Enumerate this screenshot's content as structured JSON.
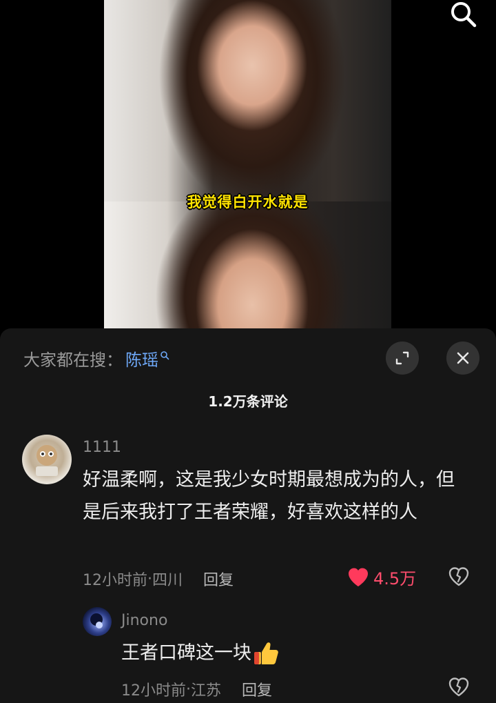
{
  "video": {
    "subtitle": "我觉得白开水就是"
  },
  "icons": {
    "search": "search-icon",
    "expand": "expand-icon",
    "close": "close-icon",
    "like": "heart-icon",
    "dislike": "broken-heart-icon",
    "thumbs_up": "thumbs-up-emoji"
  },
  "colors": {
    "accent_link": "#6ea8f7",
    "like_red": "#ff4d6d",
    "subtitle_yellow": "#ffe300",
    "sheet_bg": "#161616"
  },
  "sheet": {
    "trending_prefix": "大家都在搜：",
    "trending_keyword": "陈瑶",
    "comment_count": "1.2万条评论"
  },
  "comments": [
    {
      "username": "1111",
      "text": "好温柔啊，这是我少女时期最想成为的人，但是后来我打了王者荣耀，好喜欢这样的人",
      "time": "12小时前",
      "location": "四川",
      "separator": " · ",
      "reply_label": "回复",
      "likes": "4.5万"
    },
    {
      "username": "Jinono",
      "text": "王者口碑这一块",
      "time": "12小时前",
      "location": "江苏",
      "separator": " · ",
      "reply_label": "回复"
    }
  ]
}
